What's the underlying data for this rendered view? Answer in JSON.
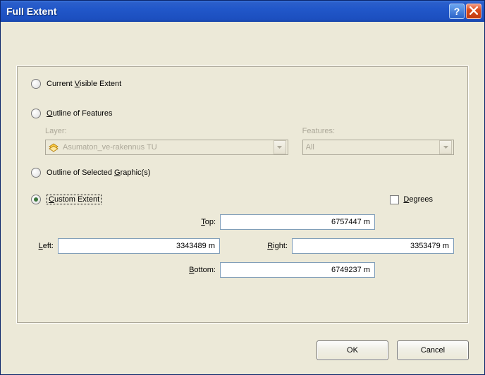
{
  "window": {
    "title": "Full Extent"
  },
  "options": {
    "current_visible": {
      "label_pre": "Current ",
      "mn": "V",
      "label_post": "isible Extent",
      "selected": false
    },
    "outline_features": {
      "mn": "O",
      "label_post": "utline of Features",
      "selected": false,
      "layer_label": "Layer:",
      "layer_value": "Asumaton_ve-rakennus TU",
      "features_label": "Features:",
      "features_value": "All"
    },
    "outline_graphic": {
      "label_pre": "Outline of Selected ",
      "mn": "G",
      "label_post": "raphic(s)",
      "selected": false
    },
    "custom_extent": {
      "mn": "C",
      "label_post": "ustom Extent",
      "selected": true
    },
    "degrees": {
      "mn": "D",
      "label_post": "egrees",
      "checked": false
    }
  },
  "extent": {
    "top": {
      "mn": "T",
      "label_post": "op:",
      "value": "6757447 m"
    },
    "left": {
      "mn": "L",
      "label_post": "eft:",
      "value": "3343489 m"
    },
    "right": {
      "mn": "R",
      "label_post": "ight:",
      "value": "3353479 m"
    },
    "bottom": {
      "mn": "B",
      "label_post": "ottom:",
      "value": "6749237 m"
    }
  },
  "buttons": {
    "ok": "OK",
    "cancel": "Cancel"
  }
}
